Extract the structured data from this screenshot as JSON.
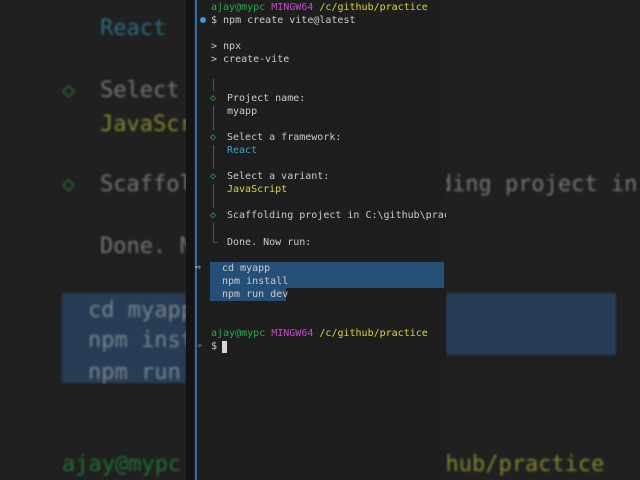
{
  "terminal": {
    "prompt1": {
      "user": "ajay@mypc",
      "system": "MINGW64",
      "path": "/c/github/practice"
    },
    "command": "$ npm create vite@latest",
    "npx_lines": [
      "> npx",
      "> create-vite"
    ],
    "steps": [
      {
        "label": "Project name:",
        "value": "myapp"
      },
      {
        "label": "Select a framework:",
        "value": "React"
      },
      {
        "label": "Select a variant:",
        "value": "JavaScript"
      },
      {
        "label": "Scaffolding project in C:\\github\\practice\\myapp..."
      }
    ],
    "done": "Done. Now run:",
    "next_commands": [
      "cd myapp",
      "npm install",
      "npm run dev"
    ],
    "prompt2": {
      "user": "ajay@mypc",
      "system": "MINGW64",
      "path": "/c/github/practice",
      "symbol": "$"
    }
  },
  "colors": {
    "user": "#23b04a",
    "system": "#c44ac4",
    "path": "#d7d73a",
    "framework": "#3aa6c8",
    "selection": "#264f78"
  }
}
